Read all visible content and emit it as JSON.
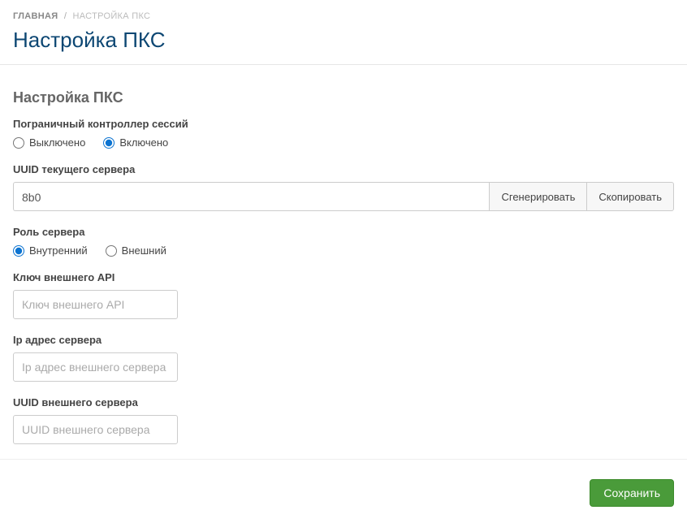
{
  "breadcrumb": {
    "home": "ГЛАВНАЯ",
    "current": "НАСТРОЙКА ПКС"
  },
  "page_title": "Настройка ПКС",
  "section_title": "Настройка ПКС",
  "sbc": {
    "label": "Пограничный контроллер сессий",
    "off": "Выключено",
    "on": "Включено",
    "selected": "on"
  },
  "uuid_current": {
    "label": "UUID текущего сервера",
    "value": "8b0",
    "generate_btn": "Сгенерировать",
    "copy_btn": "Скопировать"
  },
  "server_role": {
    "label": "Роль сервера",
    "internal": "Внутренний",
    "external": "Внешний",
    "selected": "internal"
  },
  "external_api_key": {
    "label": "Ключ внешнего API",
    "placeholder": "Ключ внешнего API",
    "value": ""
  },
  "server_ip": {
    "label": "Ip адрес сервера",
    "placeholder": "Ip адрес внешнего сервера",
    "value": ""
  },
  "external_uuid": {
    "label": "UUID внешнего сервера",
    "placeholder": "UUID внешнего сервера",
    "value": ""
  },
  "save_btn": "Сохранить"
}
